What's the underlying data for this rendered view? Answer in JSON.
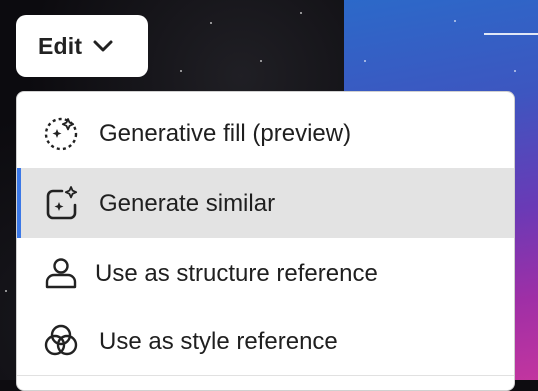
{
  "edit_button": {
    "label": "Edit",
    "icon": "chevron-down-icon"
  },
  "menu": {
    "items": [
      {
        "label": "Generative fill (preview)",
        "icon": "generative-fill-icon",
        "selected": false
      },
      {
        "label": "Generate similar",
        "icon": "generate-similar-icon",
        "selected": true
      },
      {
        "label": "Use as structure reference",
        "icon": "structure-reference-icon",
        "selected": false
      },
      {
        "label": "Use as style reference",
        "icon": "style-reference-icon",
        "selected": false
      }
    ]
  },
  "colors": {
    "accent": "#3b78e7",
    "selected_bg": "#e3e3e3",
    "menu_bg": "#ffffff",
    "text": "#1f1f1f"
  }
}
